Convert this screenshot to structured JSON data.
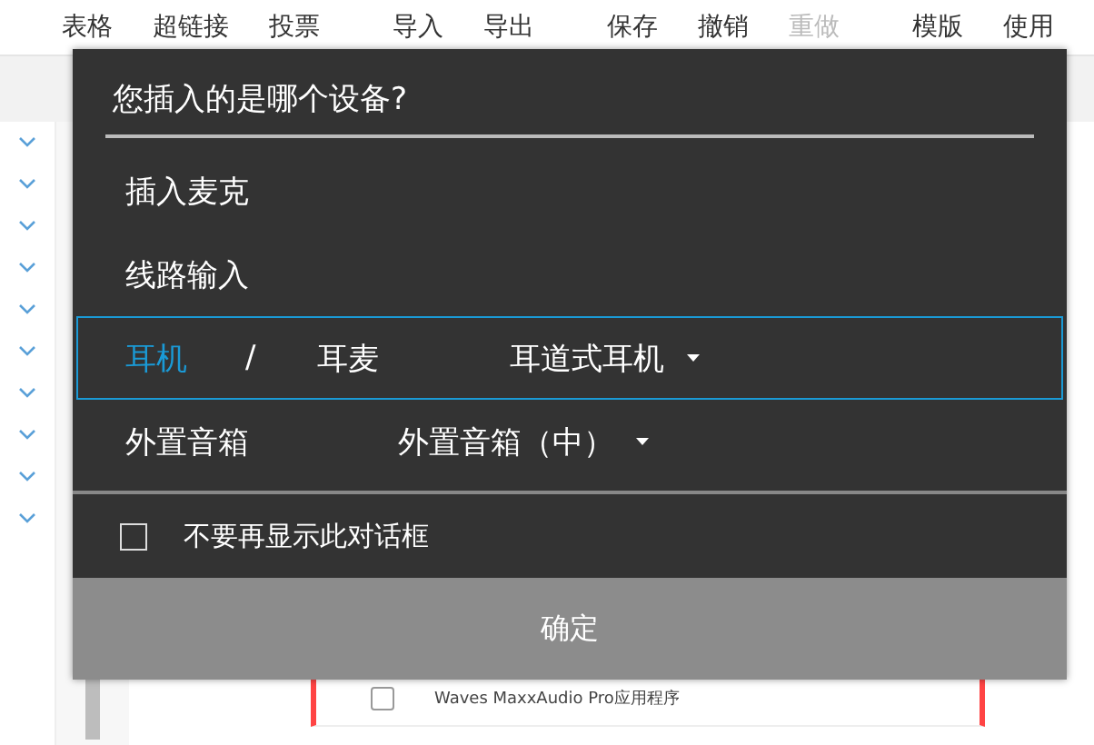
{
  "toolbar": {
    "items": [
      {
        "label": "表格",
        "disabled": false
      },
      {
        "label": "超链接",
        "disabled": false
      },
      {
        "label": "投票",
        "disabled": false
      },
      {
        "label": "导入",
        "disabled": false
      },
      {
        "label": "导出",
        "disabled": false
      },
      {
        "label": "保存",
        "disabled": false
      },
      {
        "label": "撤销",
        "disabled": false
      },
      {
        "label": "重做",
        "disabled": true
      },
      {
        "label": "模版",
        "disabled": false
      },
      {
        "label": "使用",
        "disabled": false
      }
    ]
  },
  "table": {
    "rows": [
      {
        "name": "Waves MaxxAudio Pro应用程序",
        "checked": false
      }
    ]
  },
  "dialog": {
    "title": "您插入的是哪个设备?",
    "options": [
      {
        "kind": "plain",
        "label": "插入麦克",
        "selected": false
      },
      {
        "kind": "plain",
        "label": "线路输入",
        "selected": false
      },
      {
        "kind": "split",
        "selected": true,
        "parts": [
          {
            "label": "耳机",
            "selected": true
          },
          {
            "label": "耳麦",
            "selected": false
          }
        ],
        "separator": "/",
        "select": "耳道式耳机"
      },
      {
        "kind": "select",
        "label": "外置音箱",
        "selected": false,
        "select": "外置音箱（中）"
      }
    ],
    "dont_show_again": {
      "label": "不要再显示此对话框",
      "checked": false
    },
    "button": "确定"
  }
}
